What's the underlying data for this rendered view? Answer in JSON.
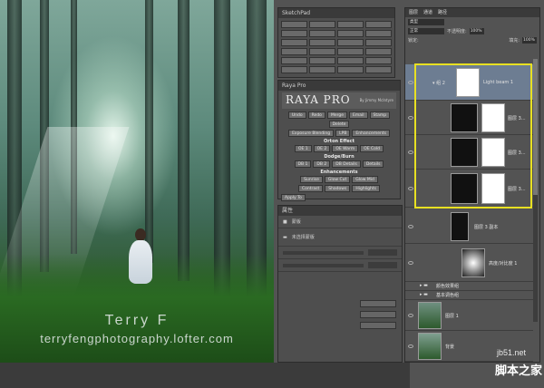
{
  "photo": {
    "watermark_name": "Terry F",
    "watermark_site": "terryfengphotography.lofter.com"
  },
  "sketch_panel": {
    "title": "SketchPad",
    "buttons": [
      "",
      "",
      "",
      "",
      "",
      "",
      "",
      "",
      "",
      "",
      "",
      "",
      "",
      "",
      "",
      "",
      "",
      "",
      "",
      "",
      "",
      "",
      "",
      ""
    ]
  },
  "raya_panel": {
    "title": "Raya Pro",
    "logo": "RAYA PRO",
    "byline": "By Jimmy McIntyre",
    "row1": [
      "Undo",
      "Redo",
      "Merge",
      "Email",
      "Stamp",
      "Delete"
    ],
    "row2": [
      "Exposure Blending",
      "LPB",
      "Enhancements"
    ],
    "section1": "Orton Effect",
    "row3": [
      "OE 1",
      "OE 2",
      "OE Warm",
      "OE Cold"
    ],
    "section2": "Dodge/Burn",
    "row4": [
      "DB 1",
      "DB 2",
      "DB Details",
      "Details"
    ],
    "section3": "Enhancements",
    "row5": [
      "Sunrise",
      "Glow Cut",
      "Glow Mid"
    ],
    "row6": [
      "Contrast",
      "Shadows",
      "Highlights"
    ],
    "row7": [
      "Apply To"
    ]
  },
  "properties_panel": {
    "title": "属性",
    "row1_label": "蒙版",
    "row2_label": "未选择蒙版"
  },
  "layers_panel": {
    "tabs": [
      "图层",
      "通道",
      "路径"
    ],
    "kind_label": "类型",
    "blend_mode": "正常",
    "opacity_label": "不透明度:",
    "opacity_value": "100%",
    "lock_label": "锁定:",
    "fill_label": "填充:",
    "fill_value": "100%",
    "layers": [
      {
        "name": "Light beam 1"
      },
      {
        "name": "图层 3..."
      },
      {
        "name": "图层 3..."
      },
      {
        "name": "图层 3..."
      },
      {
        "name": "图层 3 副本"
      },
      {
        "name": "高度/对比度 1"
      },
      {
        "name": "颜色效果组"
      },
      {
        "name": "基本调色组"
      },
      {
        "name": "图层 1"
      },
      {
        "name": "背景"
      }
    ]
  },
  "site_mark": {
    "domain": "jb51.net",
    "brand": "脚本之家"
  }
}
